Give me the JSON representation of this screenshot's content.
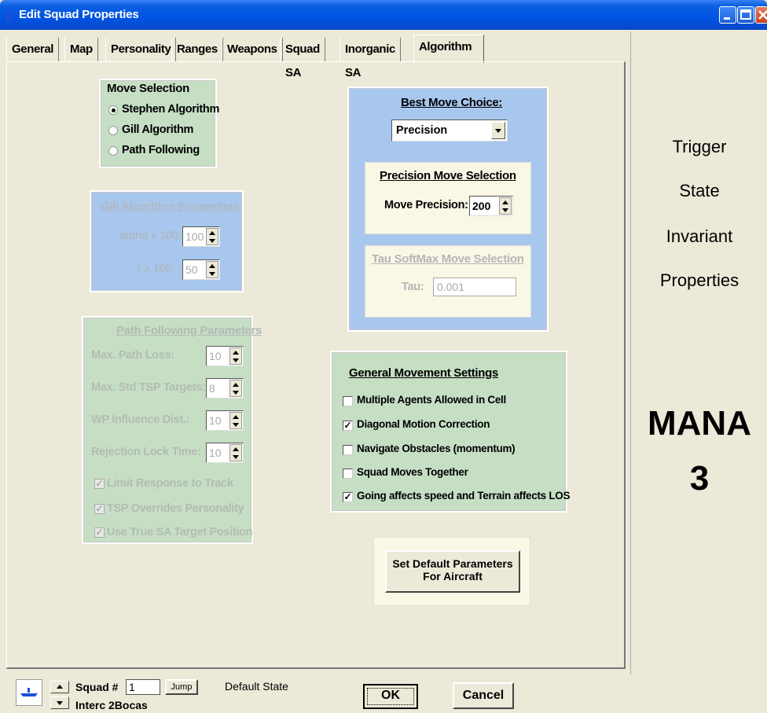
{
  "window": {
    "title": "Edit Squad Properties"
  },
  "tabs": [
    "General",
    "Map",
    "Personality",
    "Ranges",
    "Weapons",
    "Squad SA",
    "Inorganic SA",
    "Algorithm"
  ],
  "move_selection": {
    "title": "Move Selection",
    "options": [
      "Stephen Algorithm",
      "Gill Algorithm",
      "Path Following"
    ],
    "selected": "Stephen Algorithm"
  },
  "gill_params": {
    "title": "Gill Algorithm Parameters",
    "alpha_label": "alpha x 100:",
    "alpha_value": "100",
    "r_label": "r x 100:",
    "r_value": "50"
  },
  "path_params": {
    "title": "Path Following Parameters",
    "rows": [
      {
        "label": "Max. Path Loss:",
        "value": "10"
      },
      {
        "label": "Max. Std TSP Targets:",
        "value": "8"
      },
      {
        "label": "WP Influence Dist.:",
        "value": "10"
      },
      {
        "label": "Rejection Lock Time:",
        "value": "10"
      }
    ],
    "checks": [
      {
        "label": "Limit Response to Track",
        "checked": true
      },
      {
        "label": "TSP Overrides Personality",
        "checked": true
      },
      {
        "label": "Use True SA Target Position",
        "checked": true
      }
    ]
  },
  "best_move": {
    "title": "Best Move Choice:",
    "choice": "Precision",
    "precision_title": "Precision Move Selection",
    "precision_label": "Move Precision:",
    "precision_value": "200",
    "tau_title": "Tau SoftMax Move Selection",
    "tau_label": "Tau:",
    "tau_value": "0.001"
  },
  "general_movement": {
    "title": "General Movement Settings",
    "checks": [
      {
        "label": "Multiple Agents Allowed in Cell",
        "checked": false
      },
      {
        "label": "Diagonal Motion Correction",
        "checked": true
      },
      {
        "label": "Navigate Obstacles (momentum)",
        "checked": false
      },
      {
        "label": "Squad Moves Together",
        "checked": false
      },
      {
        "label": "Going affects speed and Terrain affects LOS",
        "checked": true
      }
    ]
  },
  "default_button": {
    "line1": "Set Default Parameters",
    "line2": "For Aircraft"
  },
  "right_panel": {
    "lines": [
      "Trigger",
      "State",
      "Invariant",
      "Properties"
    ],
    "mana": "MANA",
    "version": "3"
  },
  "footer": {
    "squad_label": "Squad #",
    "squad_value": "1",
    "jump": "Jump",
    "state": "Default State",
    "squad_name": "Interc  2Bocas",
    "ok": "OK",
    "cancel": "Cancel"
  },
  "colors": {
    "titlebar": "#0054e3",
    "green_panel": "#c6dfc4",
    "blue_panel": "#a7c7ee",
    "cream_panel": "#faf7e6"
  }
}
